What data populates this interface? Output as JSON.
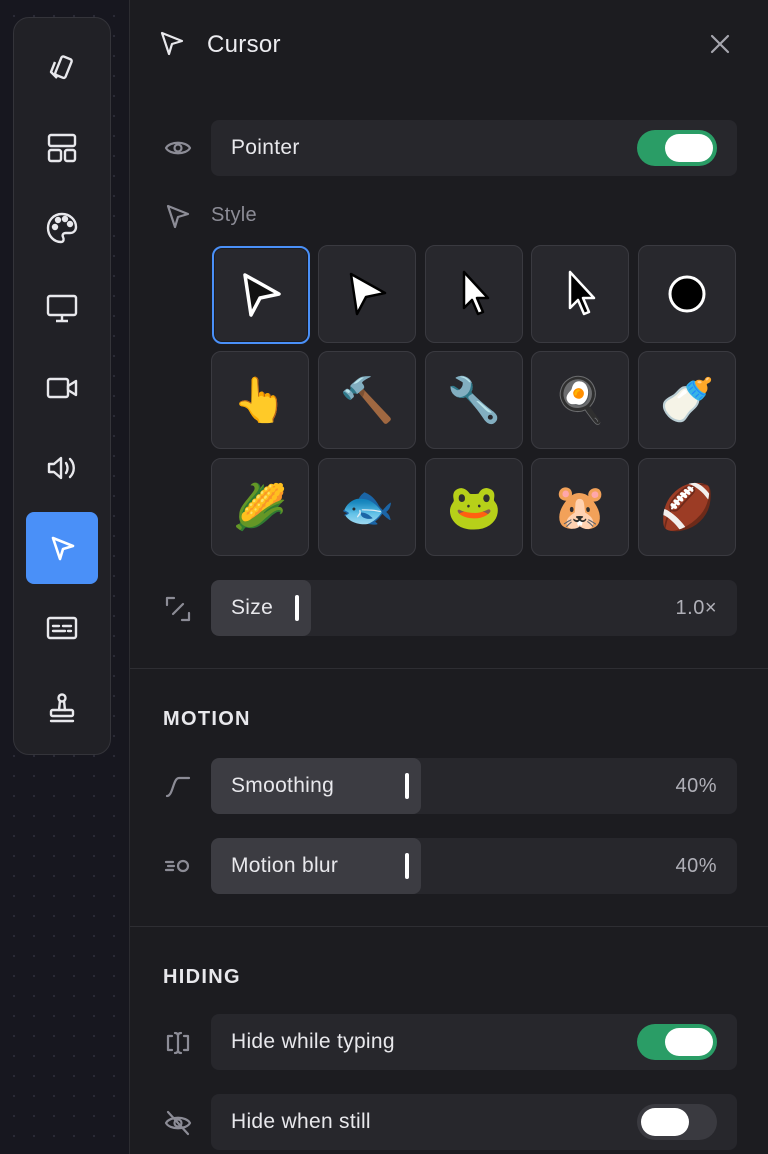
{
  "toolbar": {
    "items": [
      {
        "icon": "cards-icon",
        "active": false
      },
      {
        "icon": "layout-icon",
        "active": false
      },
      {
        "icon": "palette-icon",
        "active": false
      },
      {
        "icon": "monitor-icon",
        "active": false
      },
      {
        "icon": "video-camera-icon",
        "active": false
      },
      {
        "icon": "speaker-icon",
        "active": false
      },
      {
        "icon": "cursor-icon",
        "active": true
      },
      {
        "icon": "captions-icon",
        "active": false
      },
      {
        "icon": "stamp-icon",
        "active": false
      }
    ]
  },
  "panel": {
    "title": "Cursor",
    "pointer": {
      "label": "Pointer",
      "enabled": true
    },
    "style": {
      "label": "Style",
      "options": [
        {
          "name": "arrow-outline-dark",
          "glyph": ""
        },
        {
          "name": "arrow-white",
          "glyph": ""
        },
        {
          "name": "arrow-classic-white",
          "glyph": ""
        },
        {
          "name": "arrow-classic-black",
          "glyph": ""
        },
        {
          "name": "circle-dot",
          "glyph": ""
        },
        {
          "name": "pointing-hand",
          "glyph": "👆"
        },
        {
          "name": "hammer",
          "glyph": "🔨"
        },
        {
          "name": "wrench",
          "glyph": "🔧"
        },
        {
          "name": "frying-pan",
          "glyph": "🍳"
        },
        {
          "name": "baby-bottle",
          "glyph": "🍼"
        },
        {
          "name": "corn",
          "glyph": "🌽"
        },
        {
          "name": "fish",
          "glyph": "🐟"
        },
        {
          "name": "frog",
          "glyph": "🐸"
        },
        {
          "name": "hamster",
          "glyph": "🐹"
        },
        {
          "name": "football",
          "glyph": "🏈"
        }
      ],
      "selected_index": 0
    },
    "size": {
      "label": "Size",
      "value": "1.0×",
      "fill_fraction": 0.19
    }
  },
  "motion": {
    "title": "MOTION",
    "smoothing": {
      "label": "Smoothing",
      "value": "40%",
      "fill_fraction": 0.4
    },
    "motion_blur": {
      "label": "Motion blur",
      "value": "40%",
      "fill_fraction": 0.4
    }
  },
  "hiding": {
    "title": "HIDING",
    "hide_typing": {
      "label": "Hide while typing",
      "enabled": true
    },
    "hide_still": {
      "label": "Hide when still",
      "enabled": false
    }
  },
  "colors": {
    "accent": "#4a90f8",
    "toggle_on": "#2a9d66",
    "toggle_off": "#3a3a40"
  }
}
